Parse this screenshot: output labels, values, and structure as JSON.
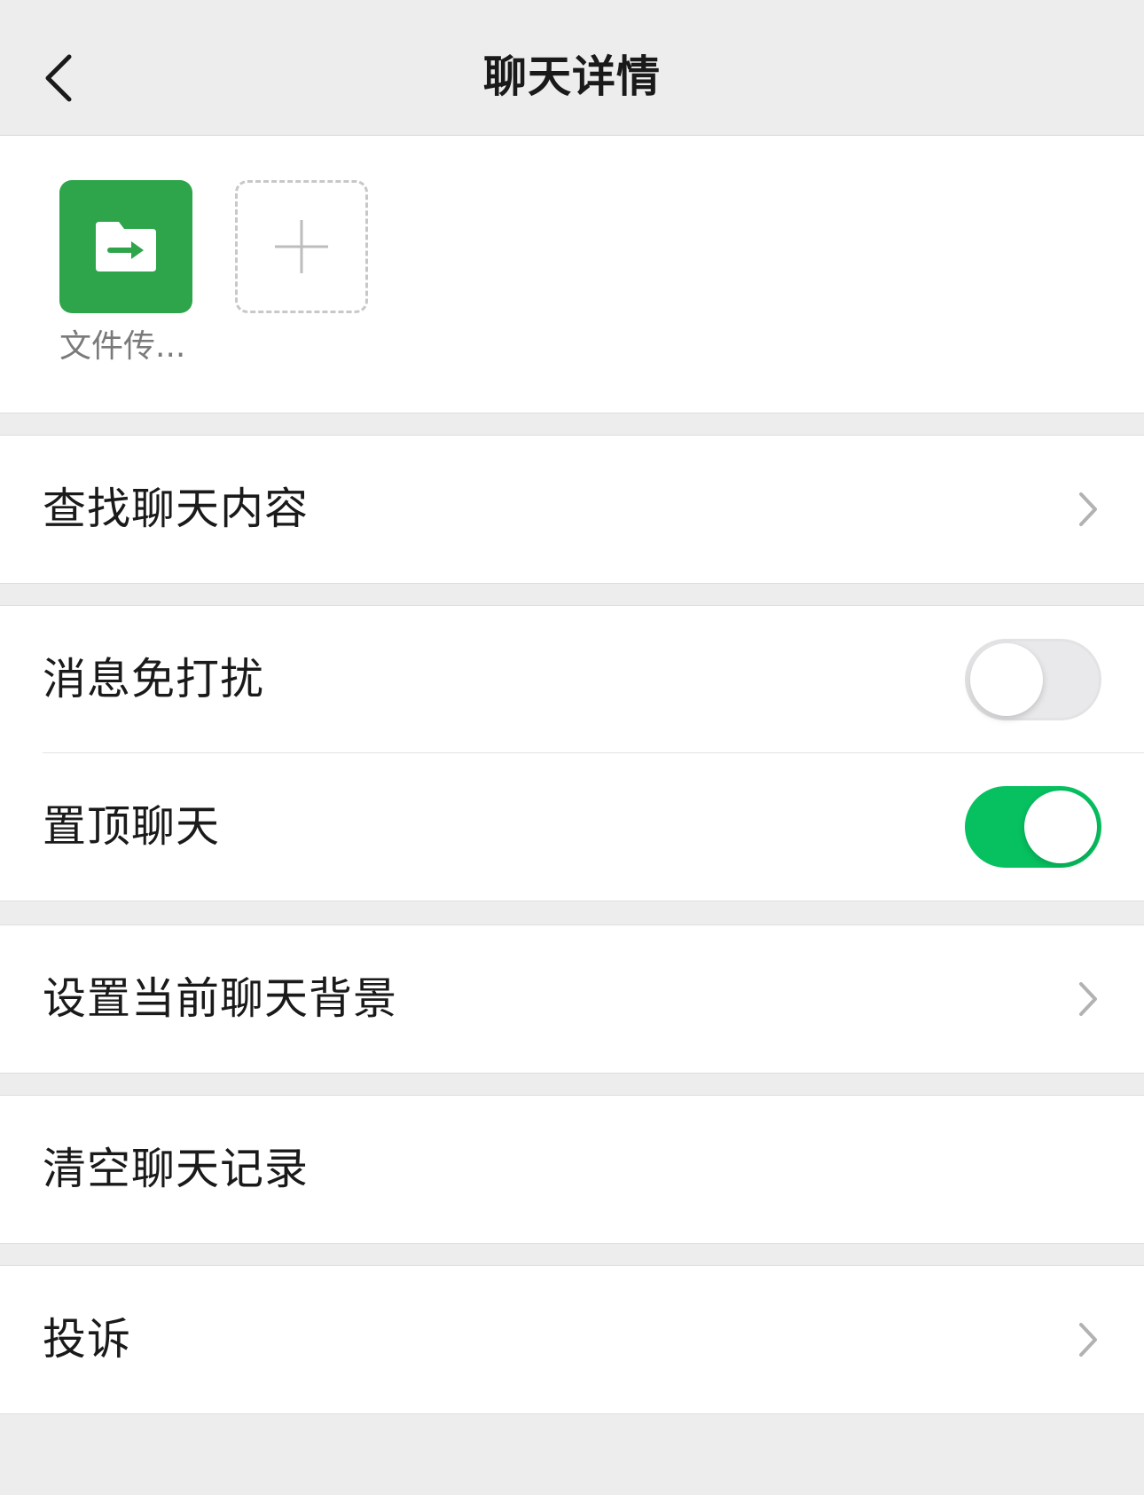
{
  "header": {
    "title": "聊天详情",
    "back_icon": "chevron-left-icon"
  },
  "members": [
    {
      "name": "文件传...",
      "avatar_icon": "file-transfer-folder-icon",
      "avatar_color": "#2ea54a"
    }
  ],
  "add_member": {
    "icon": "plus-icon"
  },
  "menu": {
    "search_chat": {
      "label": "查找聊天内容"
    },
    "mute": {
      "label": "消息免打扰",
      "enabled": false
    },
    "pin": {
      "label": "置顶聊天",
      "enabled": true
    },
    "background": {
      "label": "设置当前聊天背景"
    },
    "clear_history": {
      "label": "清空聊天记录"
    },
    "complain": {
      "label": "投诉"
    }
  },
  "colors": {
    "background": "#ededed",
    "toggle_on": "#07c160",
    "avatar_green": "#2ea54a"
  }
}
